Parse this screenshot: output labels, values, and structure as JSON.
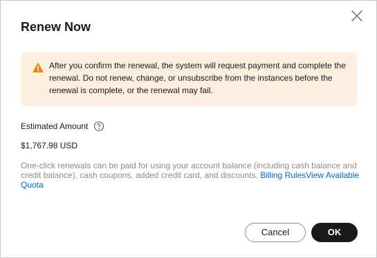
{
  "dialog": {
    "title": "Renew Now",
    "close_icon": "close-icon"
  },
  "alert": {
    "icon": "warning-icon",
    "icon_color": "#e8870f",
    "background": "#fdefe0",
    "message": "After you confirm the renewal, the system will request payment and complete the renewal. Do not renew, change, or unsubscribe from the instances before the renewal is complete, or the renewal may fail."
  },
  "amount": {
    "label": "Estimated Amount",
    "help_icon": "help-icon",
    "value": "$1,767.98 USD"
  },
  "description": {
    "text": "One-click renewals can be paid for using your account balance (including cash balance and credit balance), cash coupons, added credit card, and discounts. ",
    "link_billing_rules": "Billing Rules",
    "link_view_quota": "View Available Quota",
    "link_color": "#0066cc"
  },
  "footer": {
    "cancel_label": "Cancel",
    "ok_label": "OK"
  }
}
